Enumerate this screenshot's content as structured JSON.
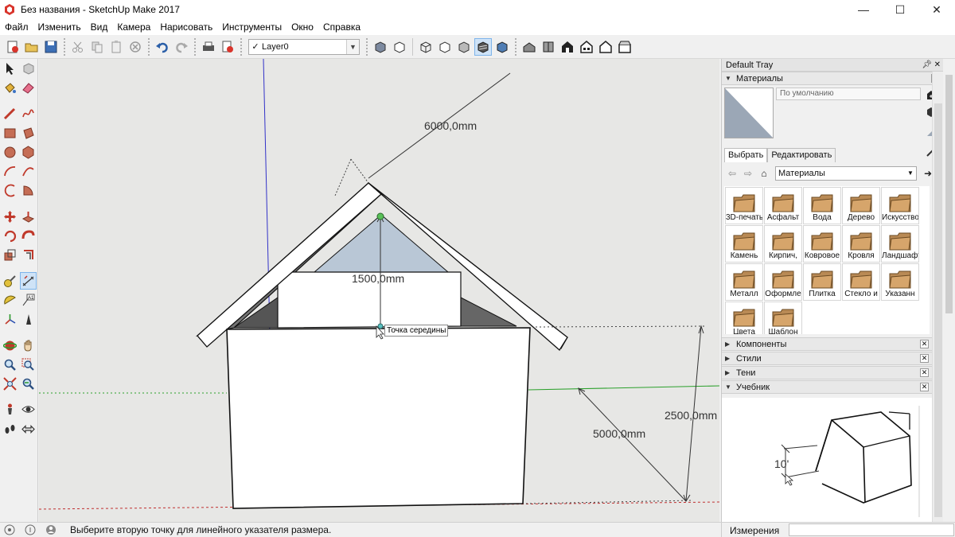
{
  "window": {
    "title": "Без названия - SketchUp Make 2017",
    "minimize": "—",
    "maximize": "☐",
    "close": "✕"
  },
  "menu": [
    "Файл",
    "Изменить",
    "Вид",
    "Камера",
    "Нарисовать",
    "Инструменты",
    "Окно",
    "Справка"
  ],
  "toolbar": {
    "layer_check": "✓",
    "layer_name": "Layer0"
  },
  "viewport": {
    "dimensions": {
      "length_6000": "6000,0mm",
      "height_1500": "1500,0mm",
      "height_2500": "2500,0mm",
      "width_5000": "5000,0mm"
    },
    "tooltip": "Точка середины"
  },
  "tray": {
    "title": "Default Tray",
    "materials_panel": {
      "title": "Материалы",
      "current_name_placeholder": "По умолчанию",
      "tab_select": "Выбрать",
      "tab_edit": "Редактировать",
      "collection": "Материалы",
      "items": [
        "3D-печать",
        "Асфальт",
        "Вода",
        "Дерево",
        "Искусство",
        "Камень",
        "Кирпич,",
        "Ковровое",
        "Кровля",
        "Ландшафт",
        "Металл",
        "Оформле",
        "Плитка",
        "Стекло и",
        "Указанн",
        "Цвета",
        "Шаблон"
      ]
    },
    "collapsed_panels": [
      "Компоненты",
      "Стили",
      "Тени"
    ],
    "tutorial_panel": {
      "title": "Учебник",
      "dimension_label": "10'"
    }
  },
  "status": {
    "message": "Выберите вторую точку для линейного указателя размера.",
    "measurements_label": "Измерения"
  }
}
